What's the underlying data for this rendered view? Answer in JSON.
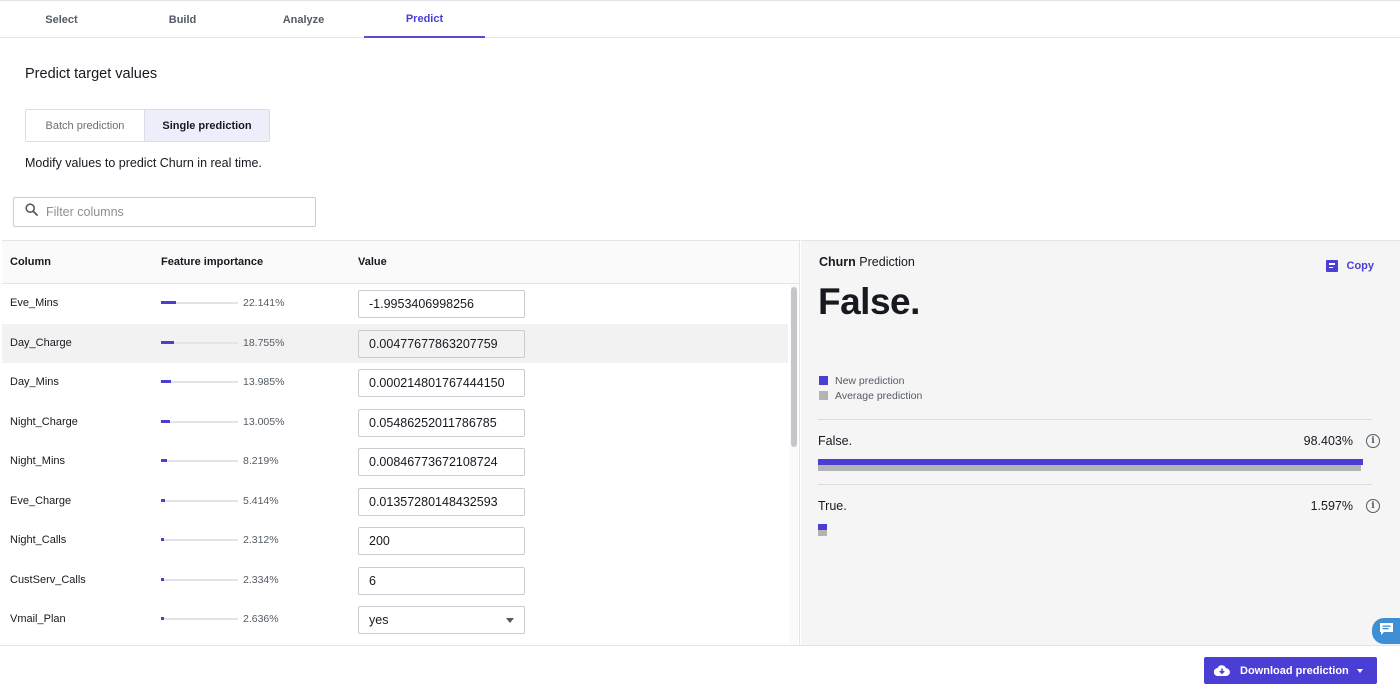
{
  "tabs": [
    {
      "label": "Select",
      "active": false
    },
    {
      "label": "Build",
      "active": false
    },
    {
      "label": "Analyze",
      "active": false
    },
    {
      "label": "Predict",
      "active": true
    }
  ],
  "page_title": "Predict target values",
  "mode_toggle": {
    "batch_label": "Batch prediction",
    "single_label": "Single prediction",
    "selected": "Single prediction"
  },
  "hint_text": "Modify values to predict Churn in real time.",
  "search": {
    "placeholder": "Filter columns",
    "value": ""
  },
  "table": {
    "headers": {
      "column": "Column",
      "importance": "Feature importance",
      "value": "Value"
    },
    "rows": [
      {
        "column": "Eve_Mins",
        "importance_pct": "22.141%",
        "importance": 0.22141,
        "value": "-1.9953406998256",
        "kind": "text",
        "shaded": false
      },
      {
        "column": "Day_Charge",
        "importance_pct": "18.755%",
        "importance": 0.18755,
        "value": "0.00477677863207759",
        "kind": "text",
        "shaded": true
      },
      {
        "column": "Day_Mins",
        "importance_pct": "13.985%",
        "importance": 0.13985,
        "value": "0.000214801767444150",
        "kind": "text",
        "shaded": false
      },
      {
        "column": "Night_Charge",
        "importance_pct": "13.005%",
        "importance": 0.13005,
        "value": "0.05486252011786785",
        "kind": "text",
        "shaded": false
      },
      {
        "column": "Night_Mins",
        "importance_pct": "8.219%",
        "importance": 0.08219,
        "value": "0.00846773672108724",
        "kind": "text",
        "shaded": false
      },
      {
        "column": "Eve_Charge",
        "importance_pct": "5.414%",
        "importance": 0.05414,
        "value": "0.01357280148432593",
        "kind": "text",
        "shaded": false
      },
      {
        "column": "Night_Calls",
        "importance_pct": "2.312%",
        "importance": 0.02312,
        "value": "200",
        "kind": "text",
        "shaded": false
      },
      {
        "column": "CustServ_Calls",
        "importance_pct": "2.334%",
        "importance": 0.02334,
        "value": "6",
        "kind": "text",
        "shaded": false
      },
      {
        "column": "Vmail_Plan",
        "importance_pct": "2.636%",
        "importance": 0.02636,
        "value": "yes",
        "kind": "select",
        "shaded": false
      }
    ]
  },
  "prediction": {
    "target": "Churn",
    "suffix": "Prediction",
    "copy_label": "Copy",
    "result": "False.",
    "legend": {
      "new": "New prediction",
      "average": "Average prediction"
    },
    "colors": {
      "new": "#4b3ed4",
      "average": "#b4b4b4"
    },
    "classes": [
      {
        "label": "False.",
        "pct": "98.403%",
        "new": 0.98403,
        "average": 0.98
      },
      {
        "label": "True.",
        "pct": "1.597%",
        "new": 0.01597,
        "average": 0.016
      }
    ]
  },
  "download_label": "Download prediction"
}
